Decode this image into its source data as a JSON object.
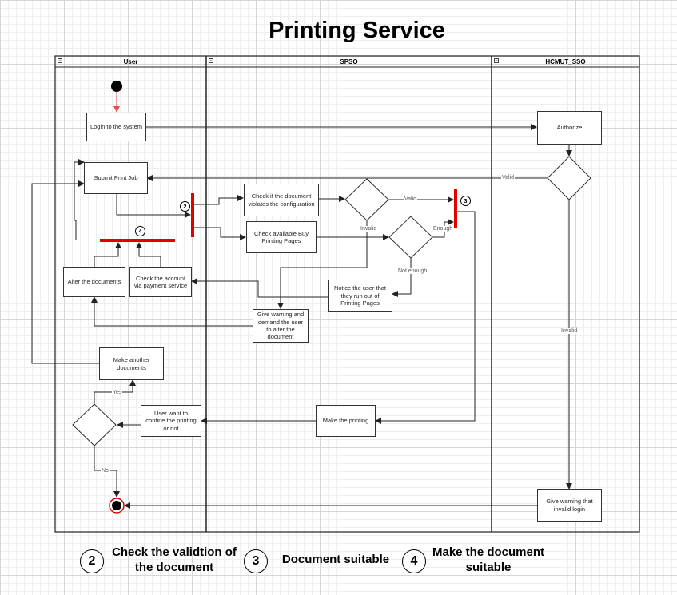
{
  "title": "Printing Service",
  "lanes": [
    {
      "name": "User"
    },
    {
      "name": "SPSO"
    },
    {
      "name": "HCMUT_SSO"
    }
  ],
  "nodes": {
    "login": "Login to the system",
    "authorize": "Authorize",
    "submit": "Submit Print Job",
    "check_config": "Check if the document violates the configuration",
    "check_pages": "Check available Buy Printing Pages",
    "alter_docs": "Alter the documents",
    "check_account": "Check the account via payment service",
    "notice_user": "Notice the user that they run out of Printing Pages",
    "give_warning_alter": "Give warning and demand the user to alter the document",
    "make_another": "Make another documents",
    "make_printing": "Make the printing",
    "continue_q": "User want to contine the printing or not",
    "invalid_login": "Give warning that invalid login"
  },
  "edge_labels": {
    "valid_auth": "Valid",
    "valid_doc": "Valid",
    "invalid_doc": "Invalid",
    "enough": "Enough",
    "not_enough": "Not enough",
    "invalid_auth": "Invalid",
    "yes": "Yes",
    "no": "No"
  },
  "markers": {
    "m2": "2",
    "m3": "3",
    "m4": "4"
  },
  "legend": [
    {
      "num": "2",
      "text": "Check the validtion of the document"
    },
    {
      "num": "3",
      "text": "Document suitable"
    },
    {
      "num": "4",
      "text": "Make the document suitable"
    }
  ],
  "colors": {
    "bar": "#e00000",
    "start": "#000000",
    "end_ring": "#e00000",
    "start_arrow": "#e05050"
  }
}
